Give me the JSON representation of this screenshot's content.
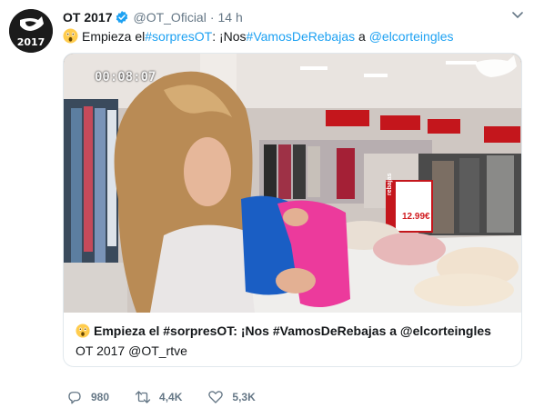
{
  "account": {
    "display_name": "OT 2017",
    "handle": "@OT_Oficial",
    "separator": "·",
    "timestamp": "14 h",
    "avatar_year": "2017",
    "verified": true
  },
  "tweet": {
    "emoji": "astonished-face",
    "segments": [
      {
        "text": "Empieza el ",
        "type": "plain"
      },
      {
        "text": "#sorpresOT",
        "type": "link"
      },
      {
        "text": ": ¡Nos ",
        "type": "plain"
      },
      {
        "text": "#VamosDeRebajas",
        "type": "link"
      },
      {
        "text": " a ",
        "type": "plain"
      },
      {
        "text": "@elcorteingles",
        "type": "link"
      }
    ]
  },
  "card": {
    "video_timestamp": "00:08:07",
    "price_label": "12.99€",
    "rebajas_label": "rebajas",
    "title": "Empieza el #sorpresOT: ¡Nos #VamosDeRebajas a @elcorteingles",
    "source": "OT 2017 @OT_rtve"
  },
  "actions": {
    "replies": "980",
    "retweets": "4,4K",
    "likes": "5,3K"
  },
  "colors": {
    "link": "#1da1f2",
    "muted": "#657786",
    "verified": "#1da1f2",
    "text": "#14171a",
    "border": "#e1e8ed"
  },
  "icons": {
    "reply": "reply-icon",
    "retweet": "retweet-icon",
    "like": "heart-icon",
    "more": "chevron-down-icon",
    "verified": "verified-badge-icon"
  }
}
